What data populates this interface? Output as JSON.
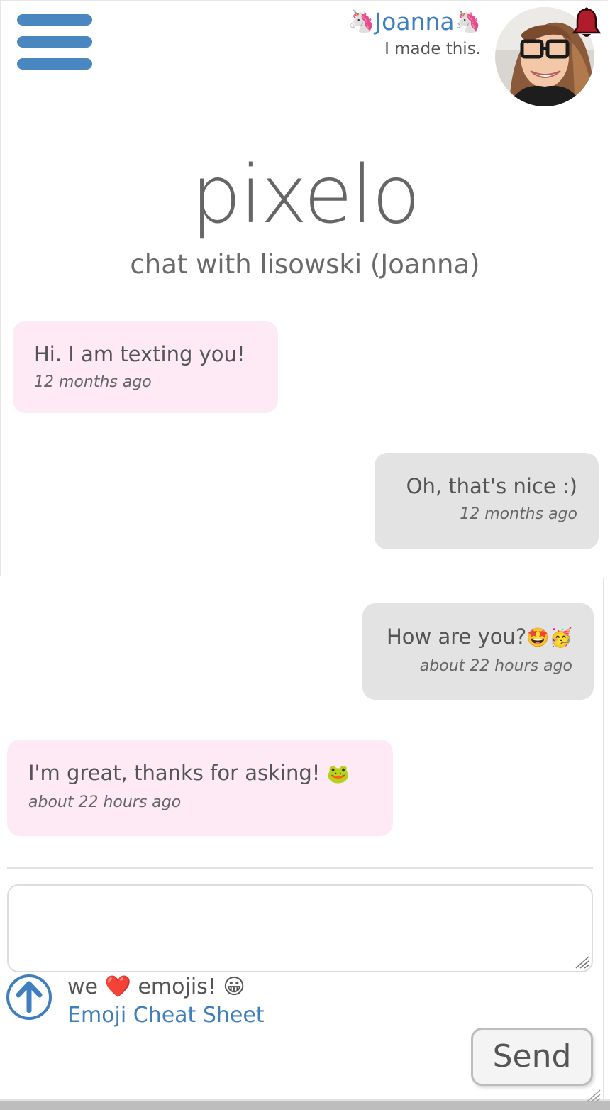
{
  "header": {
    "menu_icon": "hamburger-icon",
    "user_name": "Joanna",
    "user_name_decoration": "🦄",
    "tagline": "I made this.",
    "avatar_icon": "profile-photo",
    "notification_icon": "bell-icon",
    "accent_color": "#3f7fbf",
    "bell_color": "#b01c2a"
  },
  "title": {
    "brand": "pixelo",
    "subtitle": "chat with lisowski (Joanna)"
  },
  "messages": [
    {
      "sender": "them",
      "text": "Hi. I am texting you!",
      "emoji": "",
      "time": "12 months ago"
    },
    {
      "sender": "me",
      "text": "Oh, that's nice :)",
      "emoji": "",
      "time": "12 months ago"
    },
    {
      "sender": "me",
      "text": "How are you?",
      "emoji": "🤩🥳",
      "time": "about 22 hours ago"
    },
    {
      "sender": "them",
      "text": "I'm great, thanks for asking!",
      "emoji": "🐸",
      "time": "about 22 hours ago"
    }
  ],
  "composer": {
    "input_value": "",
    "emoji_note_prefix": "we",
    "emoji_note_heart": "❤️",
    "emoji_note_suffix": "emojis!",
    "emoji_note_smile": "😀",
    "emoji_link": "Emoji Cheat Sheet",
    "send_label": "Send",
    "scroll_top_icon": "arrow-up-circle-icon"
  },
  "colors": {
    "them_bubble": "#fdeaf5",
    "me_bubble": "#e3e3e3",
    "menu_bars": "#4a86c0"
  }
}
